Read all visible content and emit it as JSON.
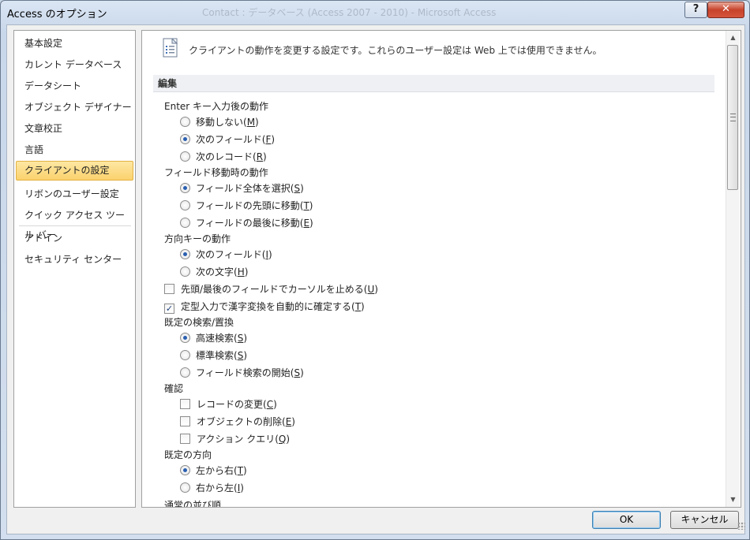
{
  "window": {
    "title": "Access のオプション",
    "background_title": "Contact : データベース (Access 2007 - 2010) - Microsoft Access",
    "help_label": "?",
    "close_label": "✕"
  },
  "sidebar": {
    "items": [
      {
        "label": "基本設定"
      },
      {
        "label": "カレント データベース"
      },
      {
        "label": "データシート"
      },
      {
        "label": "オブジェクト デザイナー"
      },
      {
        "label": "文章校正"
      },
      {
        "label": "言語"
      },
      {
        "label": "クライアントの設定"
      },
      {
        "label": "リボンのユーザー設定"
      },
      {
        "label": "クイック アクセス ツール バー"
      },
      {
        "label": "アドイン"
      },
      {
        "label": "セキュリティ センター"
      }
    ],
    "selected": "クライアントの設定"
  },
  "content": {
    "header": "クライアントの動作を変更する設定です。これらのユーザー設定は Web 上では使用できません。",
    "section_title": "編集",
    "enter_group": {
      "label": "Enter キー入力後の動作",
      "options": [
        {
          "text": "移動しない(",
          "key": "M",
          "selected": false
        },
        {
          "text": "次のフィールド(",
          "key": "F",
          "selected": true
        },
        {
          "text": "次のレコード(",
          "key": "R",
          "selected": false
        }
      ]
    },
    "field_move_group": {
      "label": "フィールド移動時の動作",
      "options": [
        {
          "text": "フィールド全体を選択(",
          "key": "S",
          "selected": true
        },
        {
          "text": "フィールドの先頭に移動(",
          "key": "T",
          "selected": false
        },
        {
          "text": "フィールドの最後に移動(",
          "key": "E",
          "selected": false
        }
      ]
    },
    "arrow_group": {
      "label": "方向キーの動作",
      "options": [
        {
          "text": "次のフィールド(",
          "key": "I",
          "selected": true
        },
        {
          "text": "次の文字(",
          "key": "H",
          "selected": false
        }
      ]
    },
    "stop_cursor": {
      "text": "先頭/最後のフィールドでカーソルを止める(",
      "key": "U",
      "checked": false
    },
    "ime_confirm": {
      "text": "定型入力で漢字変換を自動的に確定する(",
      "key": "T",
      "checked": true
    },
    "search_group": {
      "label": "既定の検索/置換",
      "options": [
        {
          "text": "高速検索(",
          "key": "S",
          "selected": true
        },
        {
          "text": "標準検索(",
          "key": "S",
          "selected": false
        },
        {
          "text": "フィールド検索の開始(",
          "key": "S",
          "selected": false
        }
      ]
    },
    "confirm_group": {
      "label": "確認",
      "options": [
        {
          "text": "レコードの変更(",
          "key": "C",
          "checked": false
        },
        {
          "text": "オブジェクトの削除(",
          "key": "E",
          "checked": false
        },
        {
          "text": "アクション クエリ(",
          "key": "Q",
          "checked": false
        }
      ]
    },
    "direction_group": {
      "label": "既定の方向",
      "options": [
        {
          "text": "左から右(",
          "key": "T",
          "selected": true
        },
        {
          "text": "右から左(",
          "key": "I",
          "selected": false
        }
      ]
    },
    "sort_group": {
      "label": "通常の並び順"
    },
    "close_paren": ")"
  },
  "buttons": {
    "ok": "OK",
    "cancel": "キャンセル"
  }
}
